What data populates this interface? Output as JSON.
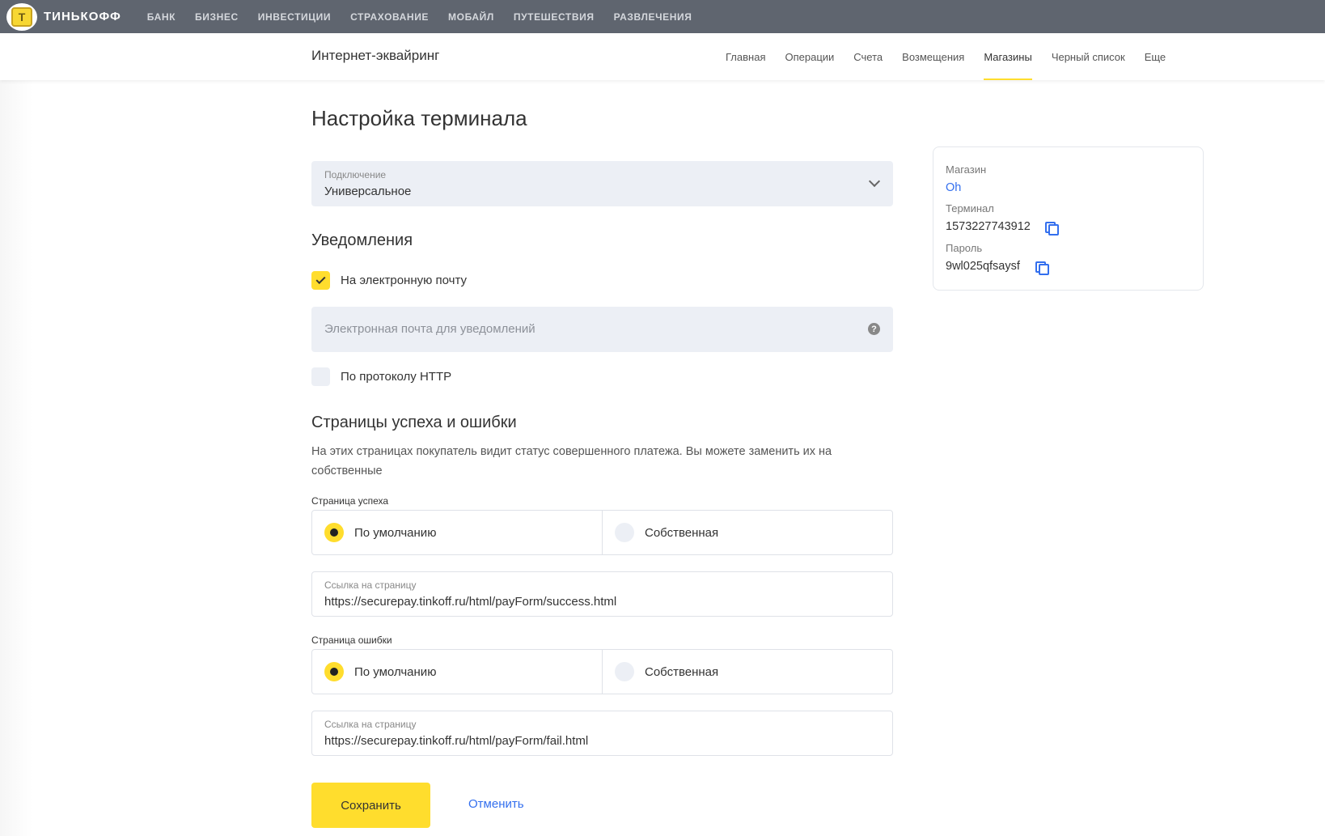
{
  "topbar": {
    "logo_text": "ТИНЬКОФФ",
    "nav": [
      "БАНК",
      "БИЗНЕС",
      "ИНВЕСТИЦИИ",
      "СТРАХОВАНИЕ",
      "МОБАЙЛ",
      "ПУТЕШЕСТВИЯ",
      "РАЗВЛЕЧЕНИЯ"
    ]
  },
  "subheader": {
    "title": "Интернет-эквайринг",
    "nav": [
      "Главная",
      "Операции",
      "Счета",
      "Возмещения",
      "Магазины",
      "Черный список",
      "Еще"
    ],
    "active": "Магазины"
  },
  "page": {
    "title": "Настройка  терминала"
  },
  "connection": {
    "label": "Подключение",
    "value": "Универсальное"
  },
  "notifications": {
    "title": "Уведомления",
    "email_checkbox": "На электронную почту",
    "email_checked": true,
    "email_placeholder": "Электронная почта для уведомлений",
    "http_checkbox": "По протоколу HTTP",
    "http_checked": false
  },
  "pages": {
    "title": "Страницы успеха и ошибки",
    "description": "На этих страницах покупатель видит статус совершенного платежа. Вы можете заменить их на собственные",
    "success": {
      "label": "Страница успеха",
      "option_default": "По умолчанию",
      "option_custom": "Собственная",
      "link_label": "Ссылка на страницу",
      "link_value": "https://securepay.tinkoff.ru/html/payForm/success.html"
    },
    "error": {
      "label": "Страница ошибки",
      "option_default": "По умолчанию",
      "option_custom": "Собственная",
      "link_label": "Ссылка на страницу",
      "link_value": "https://securepay.tinkoff.ru/html/payForm/fail.html"
    }
  },
  "actions": {
    "save": "Сохранить",
    "cancel": "Отменить"
  },
  "info": {
    "shop_label": "Магазин",
    "shop_value": "Oh",
    "terminal_label": "Терминал",
    "terminal_value": "1573227743912",
    "password_label": "Пароль",
    "password_value": "9wl025qfsaysf"
  },
  "colors": {
    "accent": "#ffdd2d",
    "link": "#336fee",
    "topbar": "#5f656f",
    "field_bg": "#eceff5"
  }
}
